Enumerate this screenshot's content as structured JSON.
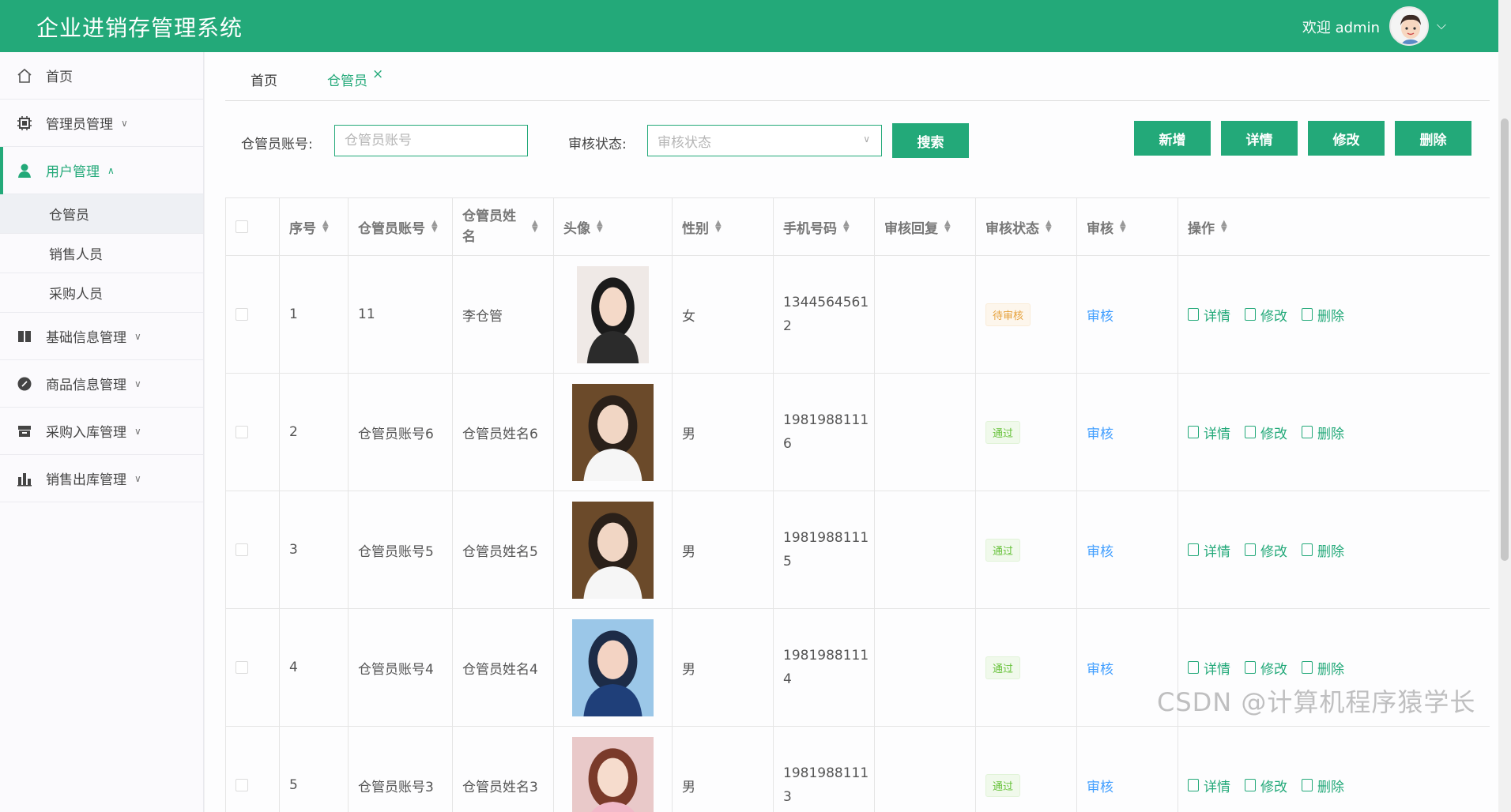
{
  "header": {
    "title": "企业进销存管理系统",
    "welcome": "欢迎 admin"
  },
  "sidebar": {
    "items": [
      {
        "label": "首页",
        "icon": "home-icon"
      },
      {
        "label": "管理员管理",
        "icon": "chip-icon"
      },
      {
        "label": "用户管理",
        "icon": "user-icon",
        "sub": [
          "仓管员",
          "销售人员",
          "采购人员"
        ]
      },
      {
        "label": "基础信息管理",
        "icon": "panel-icon"
      },
      {
        "label": "商品信息管理",
        "icon": "compass-icon"
      },
      {
        "label": "采购入库管理",
        "icon": "box-icon"
      },
      {
        "label": "销售出库管理",
        "icon": "bar-chart-icon"
      }
    ]
  },
  "tabs": [
    "首页",
    "仓管员"
  ],
  "filters": {
    "account_label": "仓管员账号:",
    "account_placeholder": "仓管员账号",
    "status_label": "审核状态:",
    "status_placeholder": "审核状态",
    "search": "搜索"
  },
  "actions": {
    "add": "新增",
    "detail": "详情",
    "edit": "修改",
    "delete": "删除"
  },
  "table": {
    "headers": [
      "序号",
      "仓管员账号",
      "仓管员姓名",
      "头像",
      "性别",
      "手机号码",
      "审核回复",
      "审核状态",
      "审核",
      "操作"
    ],
    "audit_link": "审核",
    "ops": [
      "详情",
      "修改",
      "删除"
    ],
    "rows": [
      {
        "index": "1",
        "account": "11",
        "name": "李仓管",
        "gender": "女",
        "phone_1": "1344564561",
        "phone_2": "2",
        "reply": "",
        "status": "待审核"
      },
      {
        "index": "2",
        "account": "仓管员账号6",
        "name": "仓管员姓名6",
        "gender": "男",
        "phone_1": "1981988111",
        "phone_2": "6",
        "reply": "",
        "status": "通过"
      },
      {
        "index": "3",
        "account": "仓管员账号5",
        "name": "仓管员姓名5",
        "gender": "男",
        "phone_1": "1981988111",
        "phone_2": "5",
        "reply": "",
        "status": "通过"
      },
      {
        "index": "4",
        "account": "仓管员账号4",
        "name": "仓管员姓名4",
        "gender": "男",
        "phone_1": "1981988111",
        "phone_2": "4",
        "reply": "",
        "status": "通过"
      },
      {
        "index": "5",
        "account": "仓管员账号3",
        "name": "仓管员姓名3",
        "gender": "男",
        "phone_1": "1981988111",
        "phone_2": "3",
        "reply": "",
        "status": "通过"
      }
    ]
  },
  "watermark": "CSDN @计算机程序猿学长",
  "colors": {
    "primary": "#23a979",
    "link": "#409eff"
  }
}
